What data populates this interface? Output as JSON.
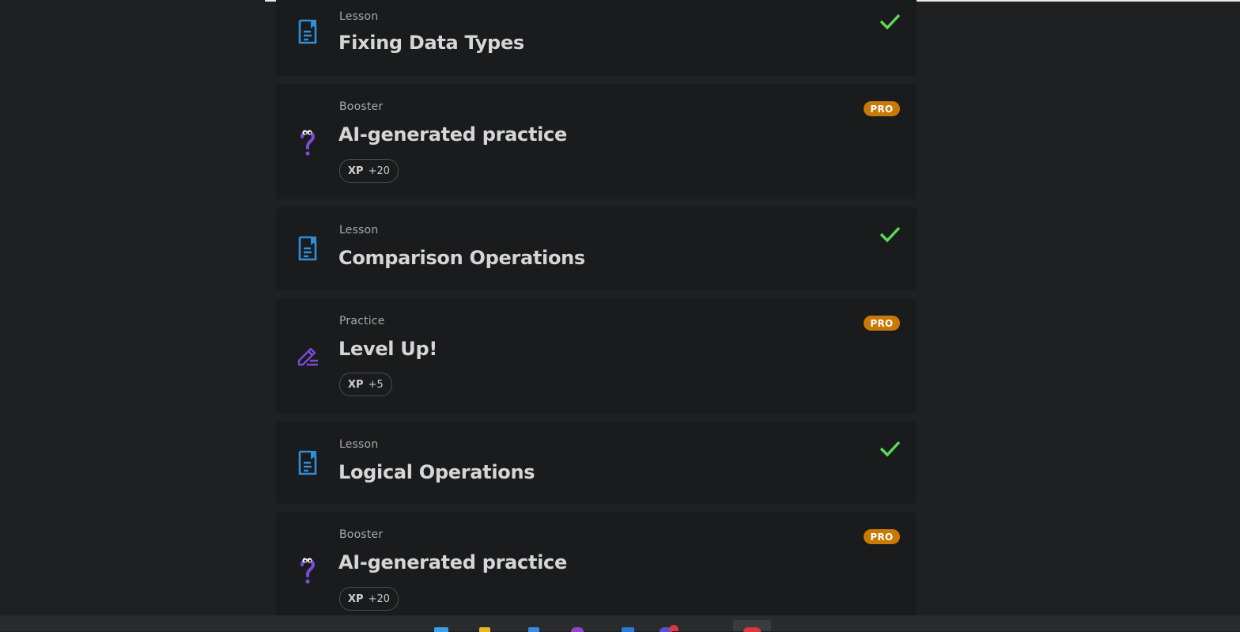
{
  "items": [
    {
      "type": "Lesson",
      "title": "Fixing Data Types",
      "icon": "lesson-icon",
      "completed": true,
      "pro": false,
      "xp": null
    },
    {
      "type": "Booster",
      "title": "AI-generated practice",
      "icon": "booster-question-icon",
      "completed": false,
      "pro": true,
      "pro_label": "PRO",
      "xp_label": "XP",
      "xp": "+20"
    },
    {
      "type": "Lesson",
      "title": "Comparison Operations",
      "icon": "lesson-icon",
      "completed": true,
      "pro": false,
      "xp": null
    },
    {
      "type": "Practice",
      "title": "Level Up!",
      "icon": "practice-pencil-icon",
      "completed": false,
      "pro": true,
      "pro_label": "PRO",
      "xp_label": "XP",
      "xp": "+5"
    },
    {
      "type": "Lesson",
      "title": "Logical Operations",
      "icon": "lesson-icon",
      "completed": true,
      "pro": false,
      "xp": null
    },
    {
      "type": "Booster",
      "title": "AI-generated practice",
      "icon": "booster-question-icon",
      "completed": false,
      "pro": true,
      "pro_label": "PRO",
      "xp_label": "XP",
      "xp": "+20"
    }
  ],
  "colors": {
    "lesson_icon": "#2f8fd8",
    "booster_icon": "#7a4bd6",
    "check": "#5ed85a",
    "pro_badge": "#c97a06"
  }
}
